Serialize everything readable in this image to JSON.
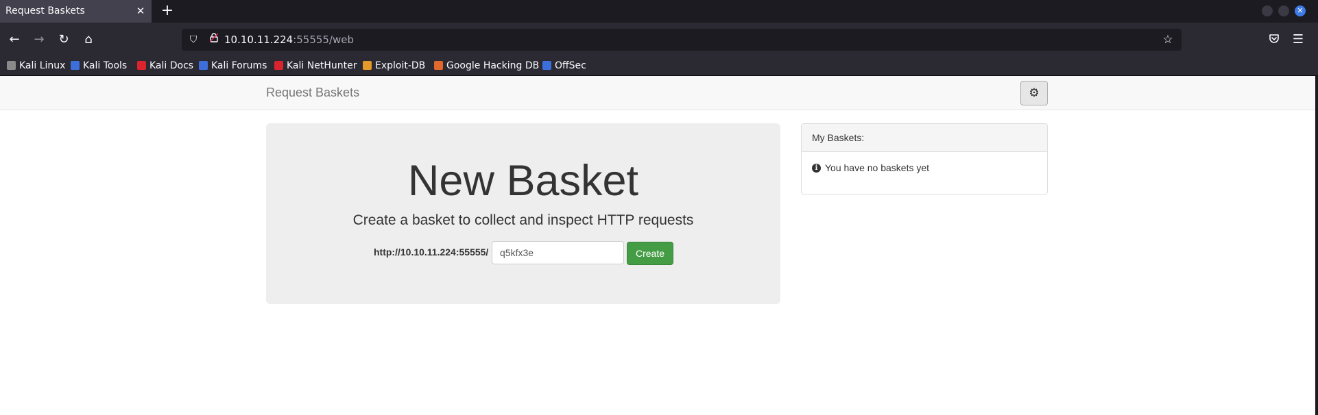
{
  "browser": {
    "tab": {
      "title": "Request Baskets",
      "close_glyph": "✕"
    },
    "new_tab_glyph": "+",
    "url": {
      "host": "10.10.11.224",
      "rest": ":55555/web"
    },
    "icons": {
      "back": "←",
      "forward": "→",
      "reload": "↻",
      "home": "⌂",
      "shield": "⛉",
      "lock": "🔒",
      "star": "☆",
      "pocket": "⛉",
      "menu": "☰"
    },
    "bookmarks": [
      {
        "label": "Kali Linux",
        "icon_color": "#8a8a8a"
      },
      {
        "label": "Kali Tools",
        "icon_color": "#3d6fdb"
      },
      {
        "label": "Kali Docs",
        "icon_color": "#d9232d"
      },
      {
        "label": "Kali Forums",
        "icon_color": "#3d6fdb"
      },
      {
        "label": "Kali NetHunter",
        "icon_color": "#d9232d"
      },
      {
        "label": "Exploit-DB",
        "icon_color": "#e39a29"
      },
      {
        "label": "Google Hacking DB",
        "icon_color": "#e0682c"
      },
      {
        "label": "OffSec",
        "icon_color": "#3d6fdb"
      }
    ]
  },
  "site": {
    "brand": "Request Baskets",
    "settings_icon": "⚙"
  },
  "jumbotron": {
    "title": "New Basket",
    "subtitle": "Create a basket to collect and inspect HTTP requests",
    "base_url": "http://10.10.11.224:55555/",
    "basket_name": "q5kfx3e",
    "create_label": "Create"
  },
  "panel": {
    "title": "My Baskets:",
    "empty_text": "You have no baskets yet",
    "info_glyph": "i"
  }
}
